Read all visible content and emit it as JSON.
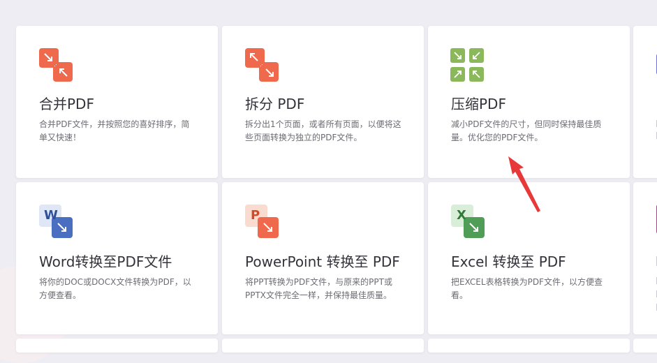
{
  "tools": [
    {
      "title": "合并PDF",
      "desc": "合并PDF文件，并按照您的喜好排序，简单又快速！",
      "icon": "merge-icon"
    },
    {
      "title": "拆分 PDF",
      "desc": "拆分出1个页面，或者所有页面，以便将这些页面转换为独立的PDF文件。",
      "icon": "split-icon"
    },
    {
      "title": "压缩PDF",
      "desc": "减小PDF文件的尺寸，但同时保持最佳质量。优化您的PDF文件。",
      "icon": "compress-icon"
    },
    {
      "title": "Word转换至PDF文件",
      "desc": "将你的DOC或DOCX文件转换为PDF，以方便查看。",
      "icon": "word-icon",
      "letter": "W"
    },
    {
      "title": "PowerPoint 转换至 PDF",
      "desc": "将PPT转换为PDF文件，与原来的PPT或PPTX文件完全一样，并保持最佳质量。",
      "icon": "powerpoint-icon",
      "letter": "P"
    },
    {
      "title": "Excel 转换至 PDF",
      "desc": "把EXCEL表格转换为PDF文件，以方便查看。",
      "icon": "excel-icon",
      "letter": "X"
    }
  ],
  "colors": {
    "merge": "#ef6a4c",
    "compress": "#8cb85c",
    "word": "#4a6fc0",
    "ppt": "#ef6a4c",
    "excel": "#4f9d57",
    "annotation": "#e8393a"
  }
}
